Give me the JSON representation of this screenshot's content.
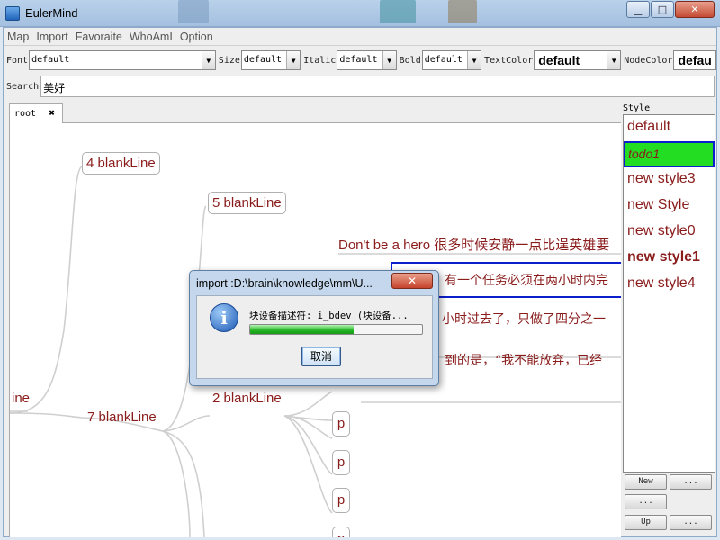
{
  "window": {
    "title": "EulerMind"
  },
  "menu": [
    "Map",
    "Import",
    "Favoraite",
    "WhoAmI",
    "Option"
  ],
  "toolbar": {
    "font_label": "Font",
    "font_value": "default",
    "size_label": "Size",
    "size_value": "default",
    "italic_label": "Italic",
    "italic_value": "default",
    "bold_label": "Bold",
    "bold_value": "default",
    "textcolor_label": "TextColor",
    "textcolor_value": "default",
    "nodecolor_label": "NodeColor",
    "nodecolor_value": "defau"
  },
  "search": {
    "label": "Search",
    "value": "美好"
  },
  "tabs": [
    {
      "label": "root"
    }
  ],
  "map": {
    "nodes": {
      "ine": "ine",
      "blank4": "4 blankLine",
      "blank5": "5 blankLine",
      "blank7": "7 blankLine",
      "blank2": "2 blankLine",
      "p": "p"
    },
    "texts": {
      "hero": "Don't be a hero 很多时候安静一点比逞英雄要",
      "line2": "有一个任务必须在两小时内完",
      "line3": "小时过去了，只做了四分之一",
      "line4": "到的是，“我不能放弃，已经"
    }
  },
  "style_panel": {
    "title": "Style",
    "items": [
      "default",
      "todo1",
      "new style3",
      "new Style",
      "new style0",
      "new style1",
      "new style4"
    ],
    "selected": "todo1",
    "buttons": {
      "new": "New",
      "dots": "...",
      "up": "Up"
    }
  },
  "dialog": {
    "title": "import :D:\\brain\\knowledge\\mm\\U...",
    "message": "块设备描述符: i_bdev (块设备...",
    "progress": 0.6,
    "cancel_label": "取消"
  }
}
